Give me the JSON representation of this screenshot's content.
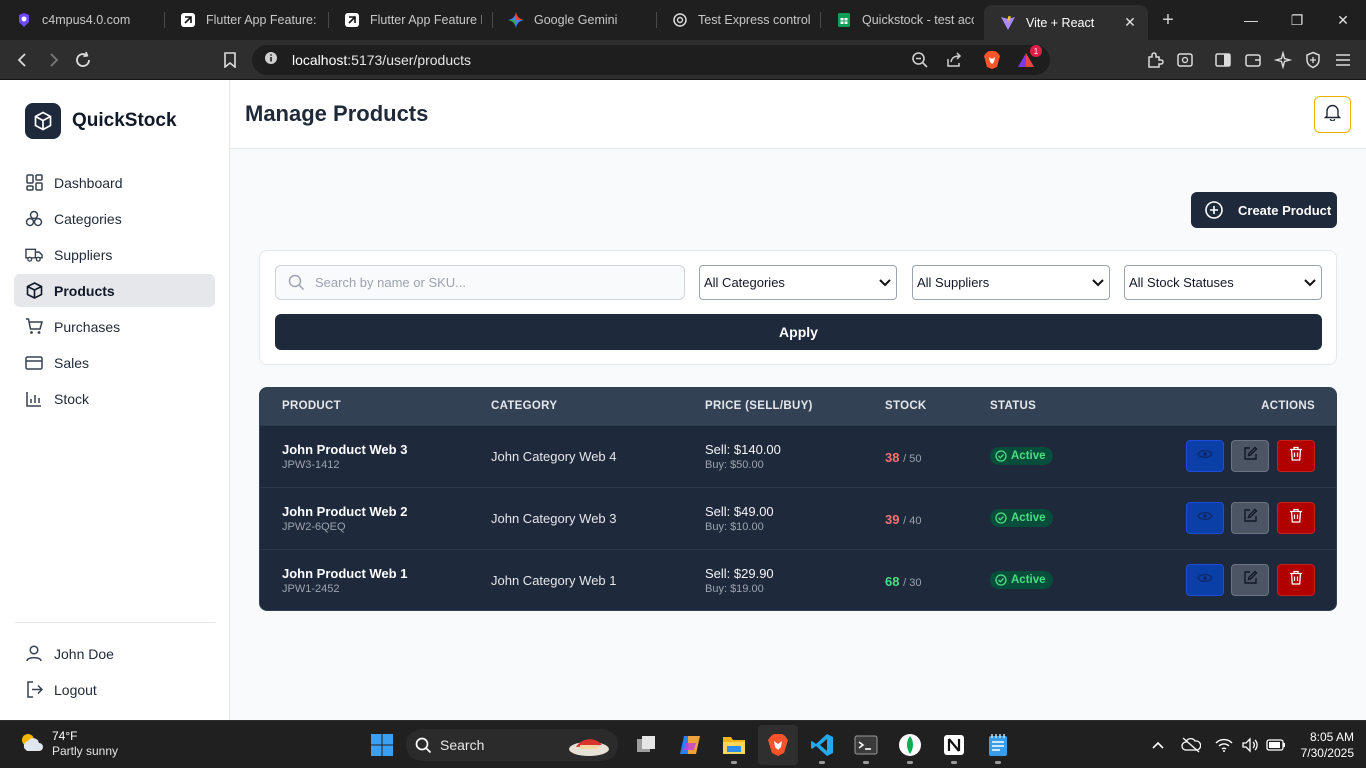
{
  "browser": {
    "tabs": [
      {
        "title": "c4mpus4.0.com",
        "icon": "c4mpus-icon",
        "active": false
      },
      {
        "title": "Flutter App Feature: C",
        "icon": "flutter-feature-icon",
        "active": false
      },
      {
        "title": "Flutter App Feature D",
        "icon": "flutter-feature-icon",
        "active": false
      },
      {
        "title": "Google Gemini",
        "icon": "gemini-icon",
        "active": false
      },
      {
        "title": "Test Express controlle",
        "icon": "openai-icon",
        "active": false
      },
      {
        "title": "Quickstock - test acco",
        "icon": "sheets-icon",
        "active": false
      },
      {
        "title": "Vite + React",
        "icon": "vite-icon",
        "active": true
      }
    ],
    "url_host": "localhost",
    "url_rest": ":5173/user/products",
    "brave_badge": "1"
  },
  "app": {
    "brand": "QuickStock",
    "nav": [
      {
        "label": "Dashboard",
        "icon": "dashboard-icon",
        "active": false
      },
      {
        "label": "Categories",
        "icon": "categories-icon",
        "active": false
      },
      {
        "label": "Suppliers",
        "icon": "truck-icon",
        "active": false
      },
      {
        "label": "Products",
        "icon": "box-icon",
        "active": true
      },
      {
        "label": "Purchases",
        "icon": "cart-icon",
        "active": false
      },
      {
        "label": "Sales",
        "icon": "credit-card-icon",
        "active": false
      },
      {
        "label": "Stock",
        "icon": "bar-chart-icon",
        "active": false
      }
    ],
    "user": {
      "name": "John Doe",
      "logout": "Logout"
    },
    "page_title": "Manage Products",
    "create_button": "Create Product",
    "filters": {
      "search_placeholder": "Search by name or SKU...",
      "search_value": "",
      "category_select": "All Categories",
      "supplier_select": "All Suppliers",
      "stock_select": "All Stock Statuses",
      "apply": "Apply"
    },
    "table": {
      "headers": {
        "product": "PRODUCT",
        "category": "CATEGORY",
        "price": "PRICE (SELL/BUY)",
        "stock": "STOCK",
        "status": "STATUS",
        "actions": "ACTIONS"
      },
      "rows": [
        {
          "name": "John Product Web 3",
          "sku": "JPW3-1412",
          "category": "John Category Web 4",
          "sell": "Sell: $140.00",
          "buy": "Buy: $50.00",
          "stock": "38",
          "stock_of": "/ 50",
          "stock_color": "#f87171",
          "status": "Active"
        },
        {
          "name": "John Product Web 2",
          "sku": "JPW2-6QEQ",
          "category": "John Category Web 3",
          "sell": "Sell: $49.00",
          "buy": "Buy: $10.00",
          "stock": "39",
          "stock_of": "/ 40",
          "stock_color": "#f87171",
          "status": "Active"
        },
        {
          "name": "John Product Web 1",
          "sku": "JPW1-2452",
          "category": "John Category Web 1",
          "sell": "Sell: $29.90",
          "buy": "Buy: $19.00",
          "stock": "68",
          "stock_of": "/ 30",
          "stock_color": "#4ade80",
          "status": "Active"
        }
      ]
    }
  },
  "taskbar": {
    "weather_temp": "74°F",
    "weather_desc": "Partly sunny",
    "search_label": "Search",
    "time": "8:05 AM",
    "date": "7/30/2025"
  }
}
